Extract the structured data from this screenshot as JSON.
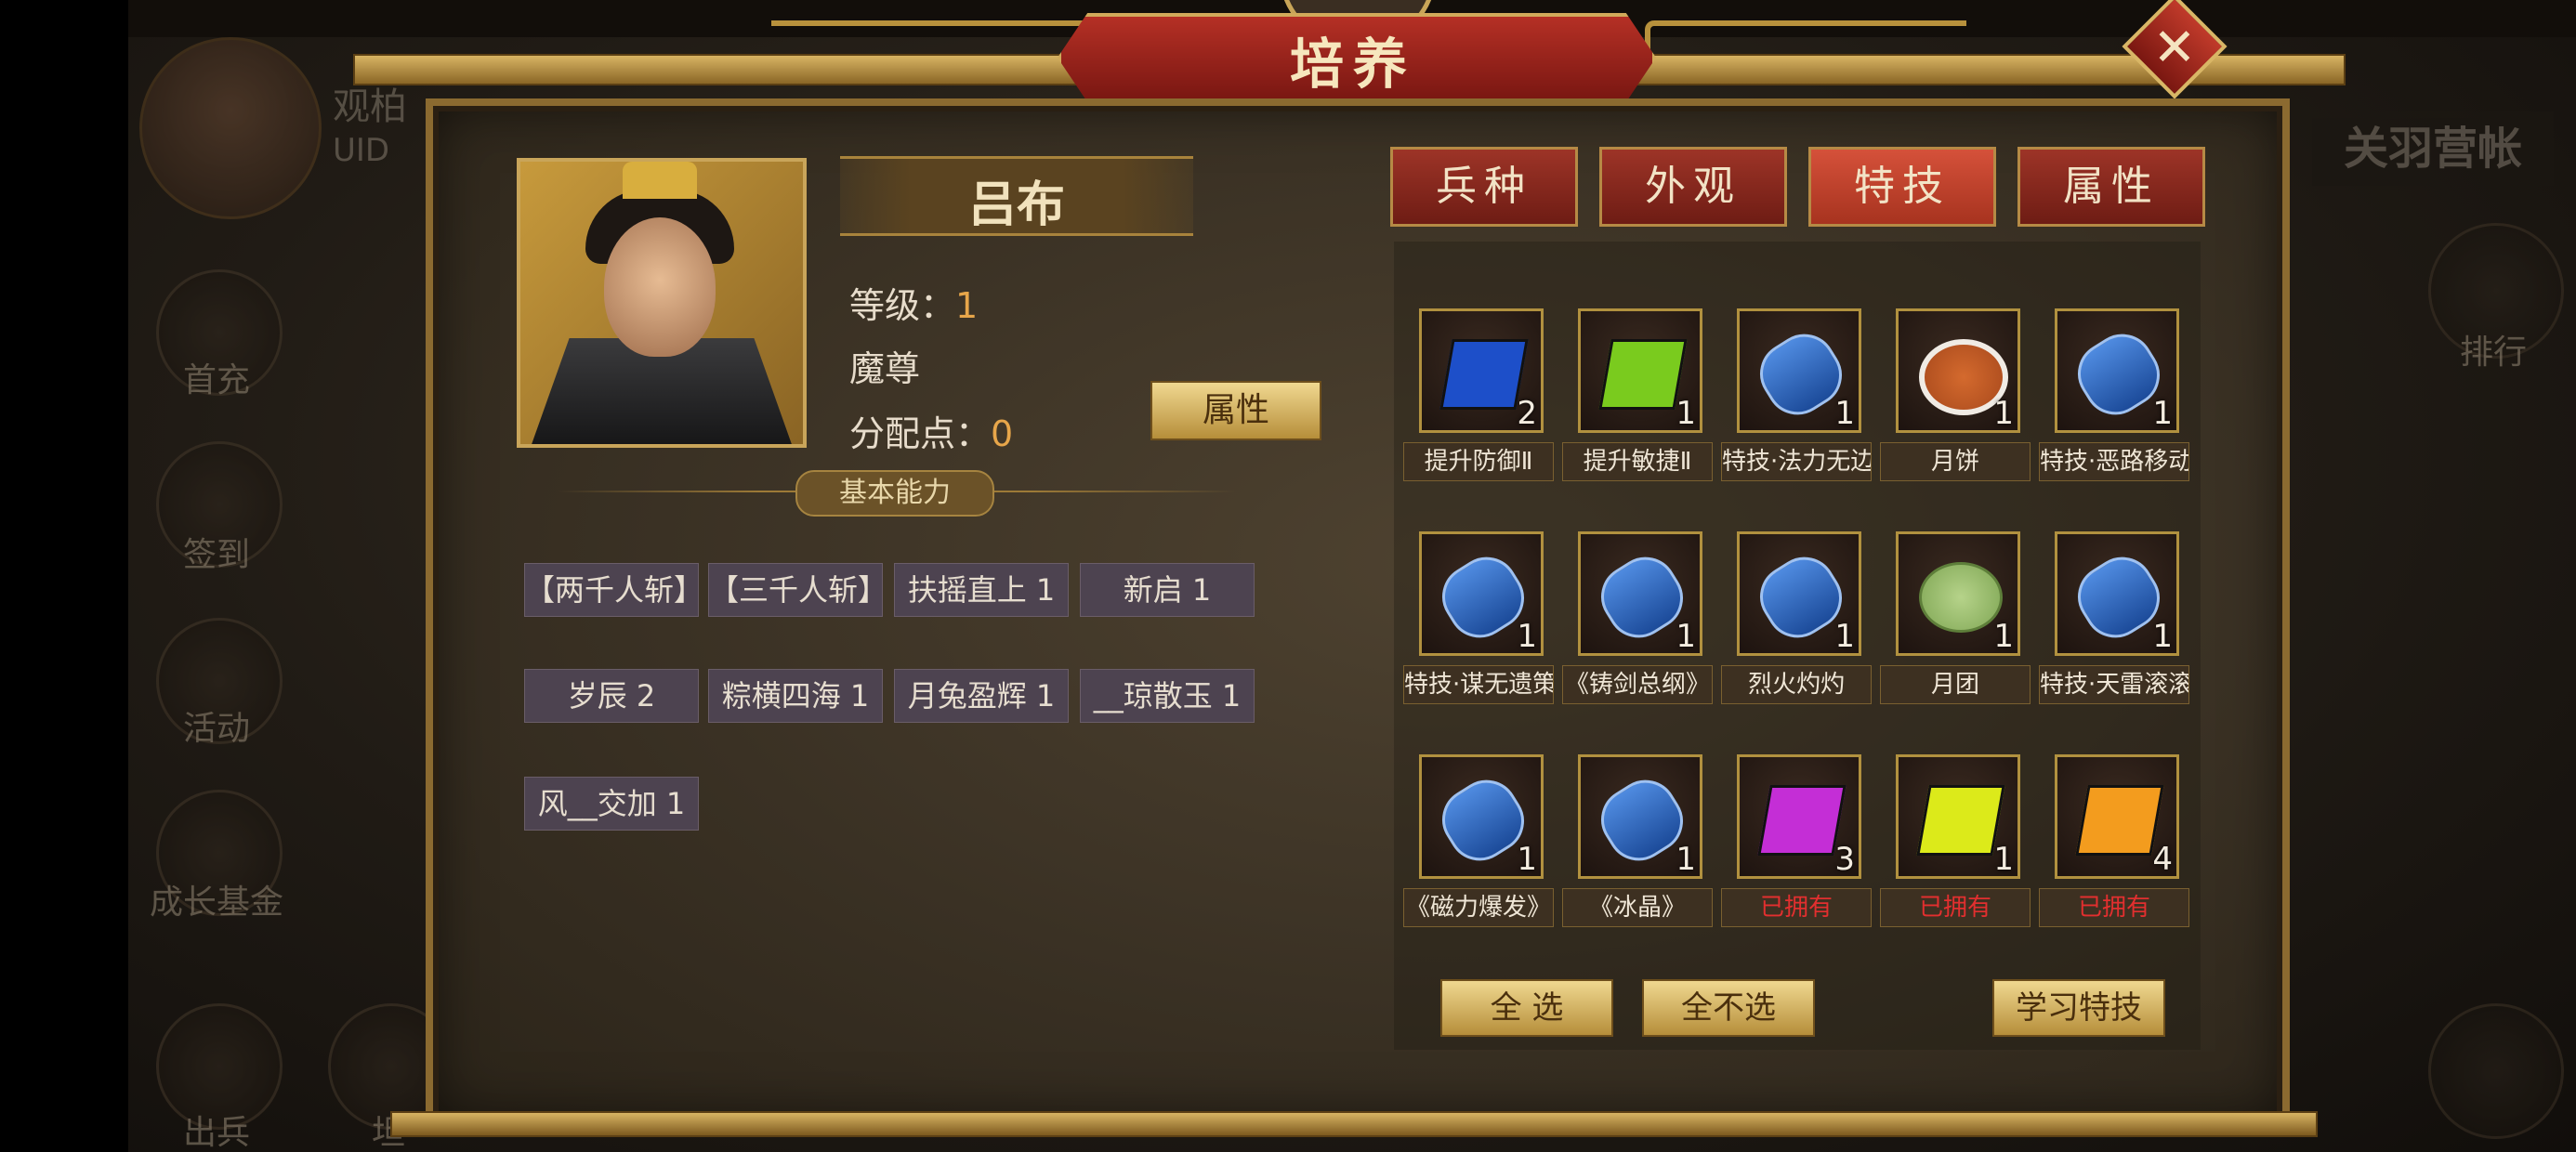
{
  "background": {
    "left_name": "观柏",
    "left_uid": "UID",
    "left_menu": [
      "首充",
      "签到",
      "活动",
      "成长基金",
      "出兵",
      "坦"
    ],
    "right_title": "关羽营帐",
    "right_menu": [
      "排行"
    ]
  },
  "dialog": {
    "title": "培养",
    "close_label": "✕"
  },
  "hero": {
    "name": "吕布",
    "level_label": "等级：",
    "level_value": "1",
    "title": "魔尊",
    "points_label": "分配点：",
    "points_value": "0",
    "attr_button": "属性",
    "basic_ability_label": "基本能力",
    "skills": [
      "【两千人斩】",
      "【三千人斩】",
      "扶摇直上 1",
      "新启 1",
      "岁辰 2",
      "粽横四海 1",
      "月兔盈辉 1",
      "__琼散玉 1",
      "风__交加 1"
    ]
  },
  "tabs": [
    {
      "label": "兵种",
      "active": false
    },
    {
      "label": "外观",
      "active": false
    },
    {
      "label": "特技",
      "active": true
    },
    {
      "label": "属性",
      "active": false
    }
  ],
  "items": [
    {
      "icon": "blue-book-icon",
      "count": "2",
      "label": "提升防御Ⅱ",
      "owned": false
    },
    {
      "icon": "green-book-icon",
      "count": "1",
      "label": "提升敏捷Ⅱ",
      "owned": false
    },
    {
      "icon": "blue-scroll-icon",
      "count": "1",
      "label": "特技·法力无边",
      "owned": false
    },
    {
      "icon": "mooncake-plate-icon",
      "count": "1",
      "label": "月饼",
      "owned": false
    },
    {
      "icon": "blue-scroll-icon",
      "count": "1",
      "label": "特技·恶路移动",
      "owned": false
    },
    {
      "icon": "blue-scroll-icon",
      "count": "1",
      "label": "特技·谋无遗策",
      "owned": false
    },
    {
      "icon": "blue-scroll-icon",
      "count": "1",
      "label": "《铸剑总纲》",
      "owned": false
    },
    {
      "icon": "blue-scroll-icon",
      "count": "1",
      "label": "烈火灼灼",
      "owned": false
    },
    {
      "icon": "green-mooncake-icon",
      "count": "1",
      "label": "月团",
      "owned": false
    },
    {
      "icon": "blue-scroll-icon",
      "count": "1",
      "label": "特技·天雷滚滚",
      "owned": false
    },
    {
      "icon": "blue-scroll-icon",
      "count": "1",
      "label": "《磁力爆发》",
      "owned": false
    },
    {
      "icon": "blue-scroll-icon",
      "count": "1",
      "label": "《冰晶》",
      "owned": false
    },
    {
      "icon": "purple-book-icon",
      "count": "3",
      "label": "已拥有",
      "owned": true
    },
    {
      "icon": "yellow-book-icon",
      "count": "1",
      "label": "已拥有",
      "owned": true
    },
    {
      "icon": "orange-book-icon",
      "count": "4",
      "label": "已拥有",
      "owned": true
    }
  ],
  "actions": {
    "select_all": "全 选",
    "select_none": "全不选",
    "learn": "学习特技"
  },
  "colors": {
    "owned_label": "#e22f2f",
    "value_accent": "#e7a64a",
    "tab_red": "#9d3427",
    "gold": "#b1913f"
  }
}
